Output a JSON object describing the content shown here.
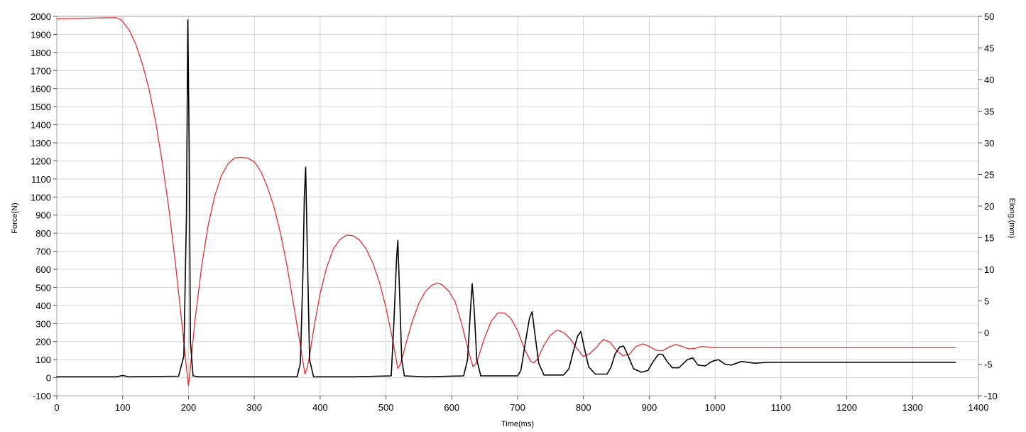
{
  "chart_data": {
    "type": "line",
    "xlabel": "Time(ms)",
    "ylabel_left": "Force(N)",
    "ylabel_right": "Elong.(mm)",
    "xlim": [
      0,
      1400
    ],
    "ylim_left": [
      -100,
      2000
    ],
    "ylim_right": [
      -10,
      50
    ],
    "grid": true,
    "x_ticks": [
      0,
      100,
      200,
      300,
      400,
      500,
      600,
      700,
      800,
      900,
      1000,
      1100,
      1200,
      1300,
      1400
    ],
    "y_left_ticks": [
      -100,
      0,
      100,
      200,
      300,
      400,
      500,
      600,
      700,
      800,
      900,
      1000,
      1100,
      1200,
      1300,
      1400,
      1500,
      1600,
      1700,
      1800,
      1900,
      2000
    ],
    "y_right_ticks": [
      -10,
      -5,
      0,
      5,
      10,
      15,
      20,
      25,
      30,
      35,
      40,
      45,
      50
    ],
    "series": [
      {
        "axis": "left",
        "color": "#000000",
        "x": [
          0,
          90,
          100,
          110,
          185,
          193,
          197,
          199,
          201,
          203,
          207,
          215,
          300,
          365,
          370,
          374,
          376,
          378,
          380,
          384,
          390,
          450,
          508,
          512,
          516,
          518,
          520,
          524,
          528,
          560,
          618,
          624,
          628,
          631,
          634,
          638,
          644,
          700,
          705,
          712,
          718,
          722,
          726,
          732,
          740,
          770,
          778,
          785,
          791,
          796,
          801,
          808,
          818,
          836,
          842,
          848,
          855,
          861,
          868,
          876,
          888,
          898,
          906,
          914,
          920,
          927,
          935,
          945,
          958,
          966,
          974,
          985,
          995,
          1005,
          1015,
          1025,
          1040,
          1060,
          1080,
          1100,
          1365
        ],
        "values": [
          5,
          5,
          12,
          5,
          8,
          120,
          900,
          1980,
          1300,
          200,
          10,
          5,
          5,
          5,
          80,
          600,
          1000,
          1165,
          800,
          100,
          5,
          5,
          10,
          300,
          650,
          760,
          550,
          100,
          10,
          5,
          10,
          100,
          350,
          520,
          380,
          100,
          10,
          10,
          40,
          200,
          330,
          365,
          250,
          80,
          15,
          15,
          50,
          150,
          230,
          255,
          170,
          60,
          20,
          20,
          60,
          130,
          170,
          175,
          120,
          50,
          30,
          40,
          90,
          130,
          130,
          90,
          55,
          55,
          100,
          110,
          70,
          65,
          90,
          100,
          75,
          70,
          90,
          80,
          85,
          85,
          85
        ]
      },
      {
        "axis": "right",
        "color": "#e03030",
        "x": [
          0,
          90,
          95,
          100,
          110,
          120,
          130,
          140,
          150,
          160,
          170,
          180,
          190,
          197,
          200,
          203,
          210,
          220,
          230,
          240,
          250,
          260,
          270,
          280,
          290,
          300,
          310,
          320,
          330,
          340,
          350,
          360,
          370,
          377,
          380,
          384,
          390,
          400,
          410,
          420,
          430,
          440,
          450,
          460,
          470,
          480,
          490,
          500,
          510,
          518,
          522,
          526,
          530,
          540,
          550,
          560,
          570,
          578,
          585,
          595,
          605,
          615,
          625,
          632,
          636,
          640,
          650,
          660,
          670,
          680,
          690,
          700,
          710,
          720,
          725,
          730,
          740,
          750,
          760,
          770,
          780,
          790,
          800,
          810,
          820,
          830,
          840,
          850,
          860,
          870,
          880,
          890,
          900,
          910,
          920,
          930,
          940,
          950,
          960,
          970,
          980,
          990,
          1000,
          1365
        ],
        "values": [
          49.6,
          49.8,
          49.6,
          49.2,
          47.8,
          45.6,
          42.5,
          38.5,
          33.4,
          27.1,
          19.8,
          11.1,
          1.4,
          -5.6,
          -8.4,
          -5.4,
          2.0,
          10.5,
          17.0,
          21.6,
          24.8,
          26.7,
          27.6,
          27.7,
          27.6,
          27.0,
          25.5,
          23.0,
          19.8,
          15.6,
          10.4,
          4.2,
          -2.0,
          -6.6,
          -5.7,
          -3.7,
          0.4,
          6.2,
          10.3,
          13.2,
          14.7,
          15.4,
          15.3,
          14.6,
          13.2,
          11.0,
          8.0,
          3.9,
          -1.0,
          -5.7,
          -5.0,
          -3.5,
          -1.9,
          1.8,
          4.6,
          6.5,
          7.5,
          7.8,
          7.6,
          6.6,
          4.9,
          1.4,
          -2.8,
          -5.4,
          -5.0,
          -4.0,
          -0.8,
          1.8,
          3.1,
          3.1,
          2.2,
          0.3,
          -2.5,
          -4.6,
          -4.8,
          -4.2,
          -2.0,
          -0.4,
          0.4,
          0.0,
          -1.0,
          -2.5,
          -3.8,
          -3.3,
          -2.3,
          -1.1,
          -1.5,
          -2.8,
          -3.7,
          -3.4,
          -2.2,
          -1.8,
          -2.2,
          -2.8,
          -2.9,
          -2.3,
          -1.9,
          -2.2,
          -2.6,
          -2.5,
          -2.2,
          -2.3,
          -2.4,
          -2.4
        ]
      }
    ]
  }
}
